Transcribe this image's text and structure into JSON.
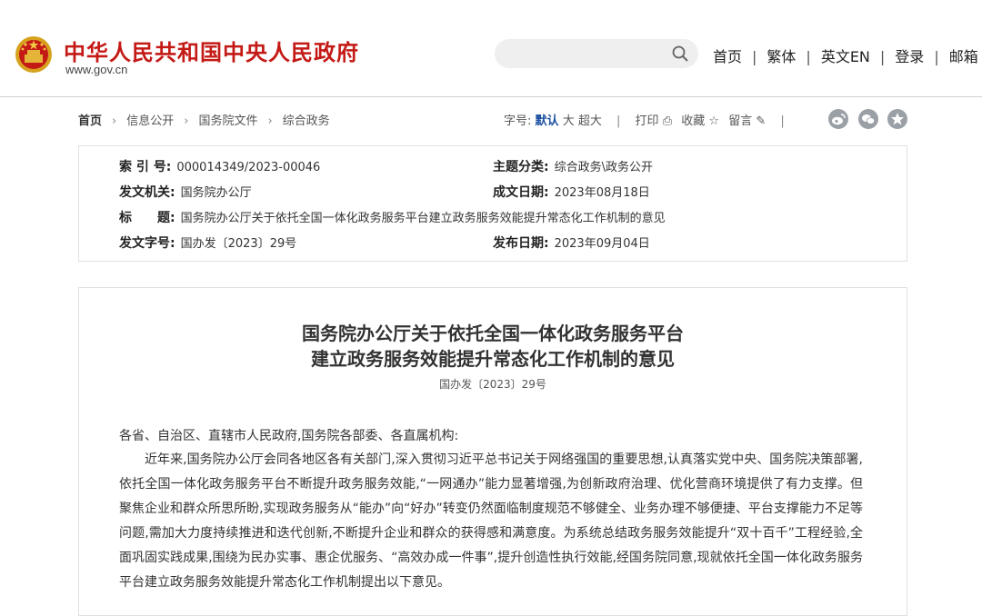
{
  "header": {
    "site_title": "中华人民共和国中央人民政府",
    "site_domain": "www.gov.cn",
    "search": {
      "placeholder": "",
      "icon": "search-icon"
    },
    "nav": [
      "首页",
      "繁体",
      "英文EN",
      "登录",
      "邮箱"
    ],
    "colors": {
      "brand_red": "#c41a16"
    }
  },
  "breadcrumb": {
    "items": [
      "首页",
      "信息公开",
      "国务院文件",
      "综合政务"
    ]
  },
  "toolbar": {
    "font_label": "字号:",
    "font_default": "默认",
    "font_large": "大",
    "font_xlarge": "超大",
    "print_label": "打印",
    "favorite_label": "收藏",
    "comment_label": "留言",
    "share_icons": [
      "weibo-icon",
      "wechat-icon",
      "qzone-icon"
    ]
  },
  "meta": {
    "index_label": "索 引 号:",
    "index_value": "000014349/2023-00046",
    "topic_label": "主题分类:",
    "topic_value": "综合政务\\政务公开",
    "issuer_label": "发文机关:",
    "issuer_value": "国务院办公厅",
    "written_label": "成文日期:",
    "written_value": "2023年08月18日",
    "title_label": "标　　题:",
    "title_value": "国务院办公厅关于依托全国一体化政务服务平台建立政务服务效能提升常态化工作机制的意见",
    "docno_label": "发文字号:",
    "docno_value": "国办发〔2023〕29号",
    "published_label": "发布日期:",
    "published_value": "2023年09月04日"
  },
  "article": {
    "title_line1": "国务院办公厅关于依托全国一体化政务服务平台",
    "title_line2": "建立政务服务效能提升常态化工作机制的意见",
    "doc_number": "国办发〔2023〕29号",
    "salutation": "各省、自治区、直辖市人民政府,国务院各部委、各直属机构:",
    "paragraph1": "近年来,国务院办公厅会同各地区各有关部门,深入贯彻习近平总书记关于网络强国的重要思想,认真落实党中央、国务院决策部署,依托全国一体化政务服务平台不断提升政务服务效能,“一网通办”能力显著增强,为创新政府治理、优化营商环境提供了有力支撑。但聚焦企业和群众所思所盼,实现政务服务从“能办”向“好办”转变仍然面临制度规范不够健全、业务办理不够便捷、平台支撑能力不足等问题,需加大力度持续推进和迭代创新,不断提升企业和群众的获得感和满意度。为系统总结政务服务效能提升“双十百千”工程经验,全面巩固实践成果,围绕为民办实事、惠企优服务、“高效办成一件事”,提升创造性执行效能,经国务院同意,现就依托全国一体化政务服务平台建立政务服务效能提升常态化工作机制提出以下意见。"
  }
}
